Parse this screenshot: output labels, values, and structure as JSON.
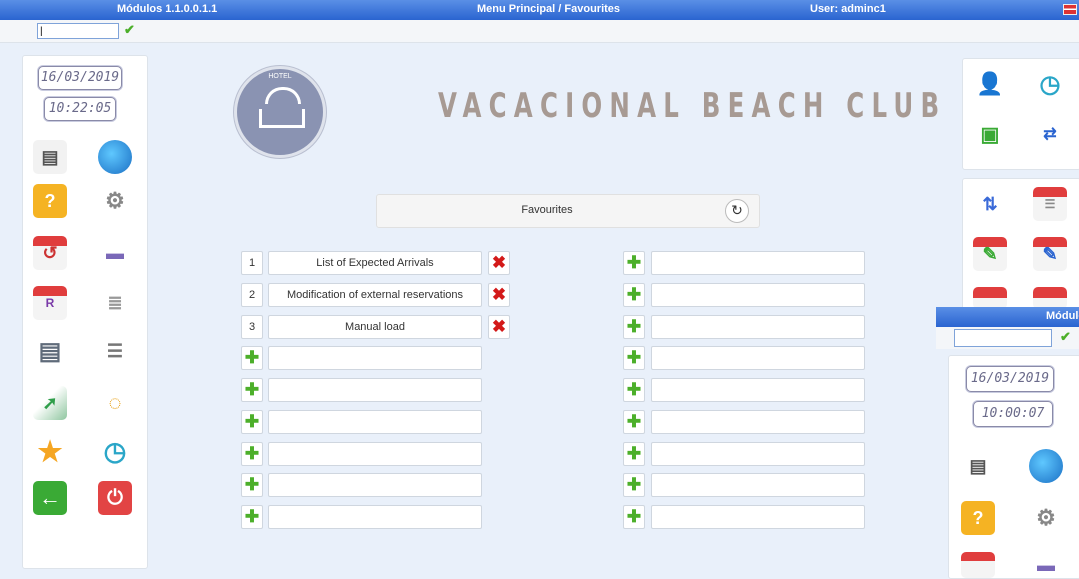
{
  "topbar": {
    "modules": "Módulos 1.1.0.0.1.1",
    "menu": "Menu Principal /  Favourites",
    "user": "User: adminc1"
  },
  "left_panel": {
    "date": "16/03/2019",
    "time": "10:22:05"
  },
  "hotel": {
    "logo_text": "HOTEL",
    "title": "VACACIONAL BEACH CLUB"
  },
  "favourites": {
    "header": "Favourites",
    "left_column": [
      {
        "num": "1",
        "label": "List of Expected Arrivals"
      },
      {
        "num": "2",
        "label": "Modification of external reservations"
      },
      {
        "num": "3",
        "label": "Manual load"
      },
      {
        "num": "",
        "label": ""
      },
      {
        "num": "",
        "label": ""
      },
      {
        "num": "",
        "label": ""
      },
      {
        "num": "",
        "label": ""
      },
      {
        "num": "",
        "label": ""
      },
      {
        "num": "",
        "label": ""
      }
    ]
  },
  "overlay": {
    "title": "Módulo",
    "date": "16/03/2019",
    "time": "10:00:07"
  },
  "colors": {
    "accent": "#2a64d0",
    "add": "#4caf2a",
    "delete": "#d31919"
  },
  "icons": [
    "book-icon",
    "globe-icon",
    "note-icon",
    "gears-icon",
    "calendar-icon",
    "bed-icon",
    "calendar-r-icon",
    "list-icon",
    "chat-icon",
    "list-search-icon",
    "image-icon",
    "sms-icon",
    "star-icon",
    "clock-icon",
    "exit-icon",
    "power-icon"
  ]
}
